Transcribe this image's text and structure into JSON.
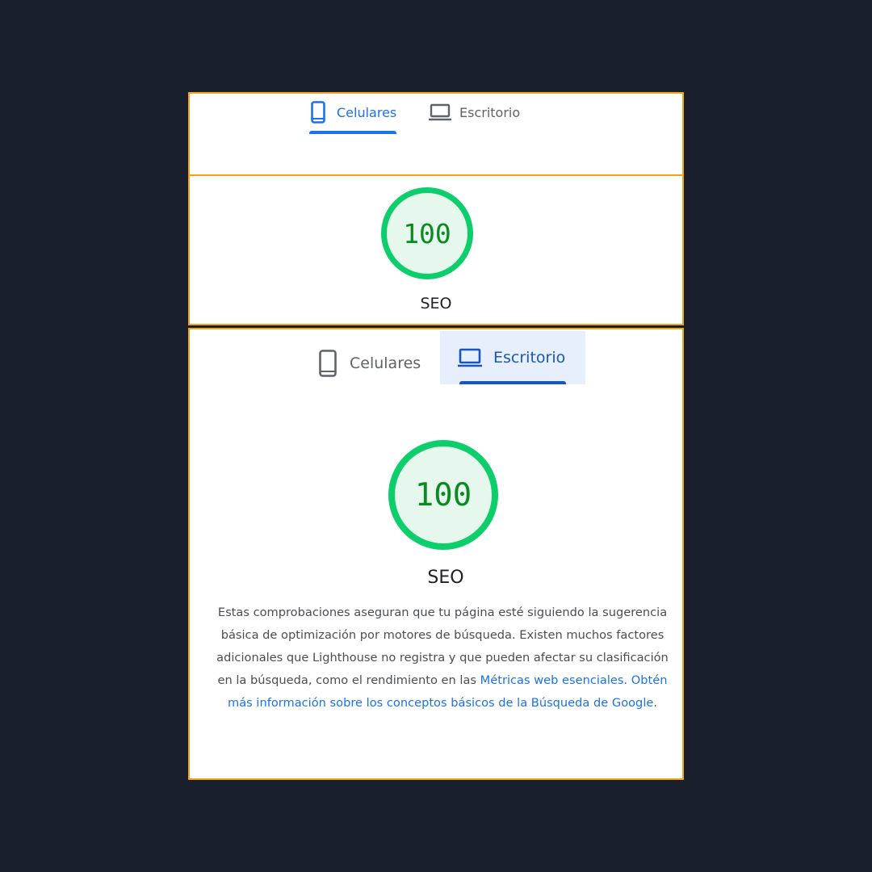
{
  "colors": {
    "page_background": "#181e2c",
    "panel_border": "#f2a417",
    "accent_blue": "#1a73e8",
    "score_green": "#0cce6b",
    "score_text": "#0b8a22"
  },
  "top_panel": {
    "tabs": [
      {
        "label": "Celulares",
        "icon": "smartphone-icon",
        "selected": true
      },
      {
        "label": "Escritorio",
        "icon": "laptop-icon",
        "selected": false
      }
    ]
  },
  "mobile_result": {
    "score": "100",
    "category": "SEO"
  },
  "desktop_panel": {
    "tabs": [
      {
        "label": "Celulares",
        "icon": "smartphone-icon",
        "selected": false
      },
      {
        "label": "Escritorio",
        "icon": "laptop-icon",
        "selected": true
      }
    ],
    "score": "100",
    "category": "SEO",
    "description": "Estas comprobaciones aseguran que tu página esté siguiendo la sugerencia básica de optimización por motores de búsqueda. Existen muchos factores adicionales que Lighthouse no registra y que pueden afectar su clasificación en la búsqueda, como el rendimiento en las",
    "link_metrics": "Métricas web esenciales",
    "link_separator": ". ",
    "link_learn_more": "Obtén más información sobre los conceptos básicos de la Búsqueda de Google",
    "trailing": "."
  }
}
